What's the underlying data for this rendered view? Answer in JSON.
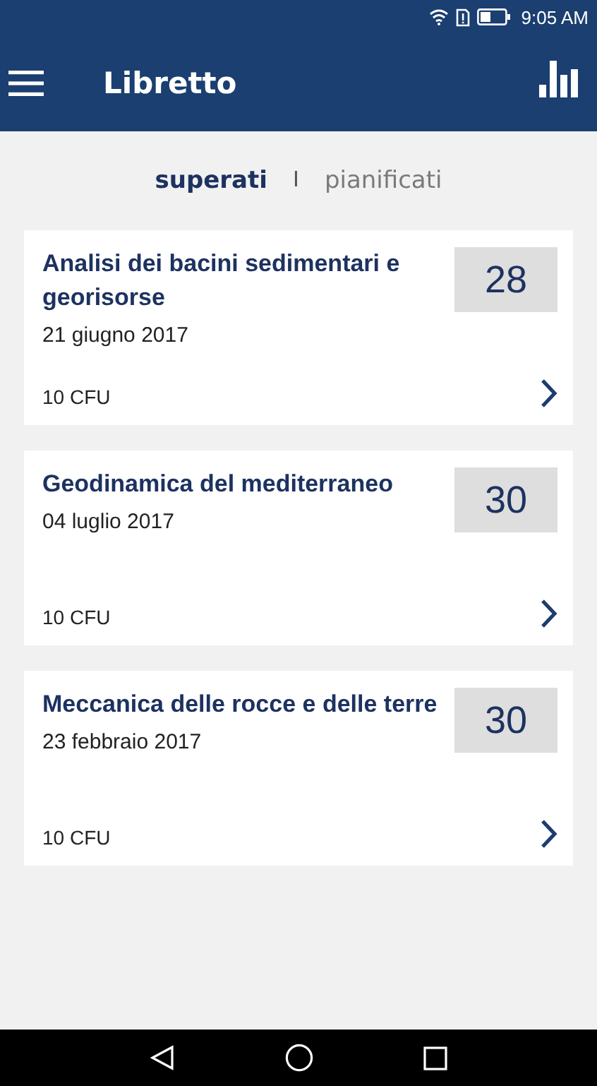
{
  "status_bar": {
    "time": "9:05 AM"
  },
  "app_bar": {
    "title": "Libretto"
  },
  "tabs": [
    {
      "label": "superati",
      "selected": true
    },
    {
      "label": "pianificati",
      "selected": false
    }
  ],
  "tab_separator": "I",
  "exams": [
    {
      "name": "Analisi dei bacini sedimentari e georisorse",
      "date": "21 giugno 2017",
      "credits": "10 CFU",
      "grade": "28"
    },
    {
      "name": "Geodinamica del mediterraneo",
      "date": "04 luglio 2017",
      "credits": "10 CFU",
      "grade": "30"
    },
    {
      "name": "Meccanica delle rocce e delle terre",
      "date": "23 febbraio 2017",
      "credits": "10 CFU",
      "grade": "30"
    }
  ]
}
